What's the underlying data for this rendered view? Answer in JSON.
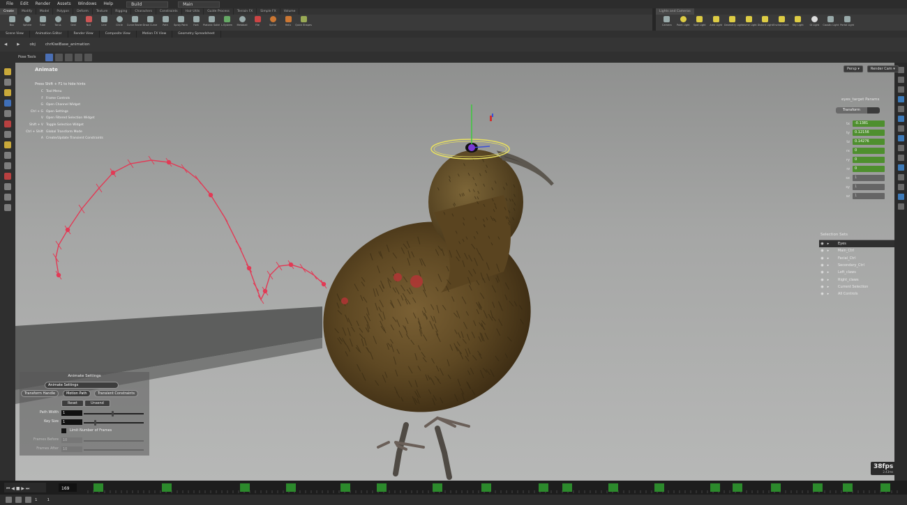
{
  "menu": {
    "items": [
      "File",
      "Edit",
      "Render",
      "Assets",
      "Windows",
      "Help"
    ],
    "desktop": "Build",
    "context": "Main"
  },
  "shelf": {
    "tabs": [
      "Create",
      "Modify",
      "Model",
      "Polygon",
      "Deform",
      "Texture",
      "Rigging",
      "Characters",
      "Constraints",
      "Hair Utils",
      "Guide Process",
      "Terrain FX",
      "Simple FX",
      "Volume"
    ],
    "tools": [
      "Box",
      "Sphere",
      "Tube",
      "Torus",
      "Grid",
      "Null",
      "Line",
      "Circle",
      "Curve Bezier",
      "Draw Curve",
      "Path",
      "Spray Paint",
      "Font",
      "Platonic Solids",
      "L-System",
      "Metaball",
      "File",
      "Spiral",
      "Helix",
      "Quick Shapes"
    ],
    "right_tab": "Lights and Cameras",
    "right_tools": [
      "Camera",
      "Point Light",
      "Spot Light",
      "Area Light",
      "Geometry Light",
      "Volume Light",
      "Distant Light",
      "Environment Light",
      "Sky Light",
      "GI Light",
      "Caustic Light",
      "Portal Light"
    ]
  },
  "pane_tabs": [
    "Scene View",
    "Animation Editor",
    "Render View",
    "Composite View",
    "Motion FX View",
    "Geometry Spreadsheet"
  ],
  "path": {
    "root": "obj",
    "node": "chrKiwiBase_animation"
  },
  "viewport_toolbar": {
    "label": "Pose Tools"
  },
  "hud": {
    "title": "Animate",
    "hint": "Press Shift + F1 to hide hints",
    "hotkeys": [
      {
        "key": "C",
        "desc": "Tool Menu"
      },
      {
        "key": "F",
        "desc": "Frame Controls"
      },
      {
        "key": "G",
        "desc": "Open Channel Widget"
      },
      {
        "key": "Ctrl + G",
        "desc": "Open Settings"
      },
      {
        "key": "V",
        "desc": "Open Filtered Selection Widget"
      },
      {
        "key": "Shift + V",
        "desc": "Toggle Selection Widget"
      },
      {
        "key": "Ctrl + Shift",
        "desc": "Global Transform Mode"
      },
      {
        "key": "A",
        "desc": "Create/Update Transient Constraints"
      }
    ]
  },
  "view_buttons": {
    "persp": "Persp ▾",
    "cam": "Render Cam ▾"
  },
  "transform_panel": {
    "header": "eyes_target Params",
    "mode": "Transform",
    "fields": [
      {
        "name": "tx",
        "value": "-0.1381",
        "active": true
      },
      {
        "name": "ty",
        "value": "0.12156",
        "active": true
      },
      {
        "name": "tz",
        "value": "0.14276",
        "active": true
      },
      {
        "name": "rx",
        "value": "0",
        "active": true
      },
      {
        "name": "ry",
        "value": "0",
        "active": true
      },
      {
        "name": "rz",
        "value": "0",
        "active": true
      },
      {
        "name": "sx",
        "value": "1",
        "active": false
      },
      {
        "name": "sy",
        "value": "1",
        "active": false
      },
      {
        "name": "sz",
        "value": "1",
        "active": false
      }
    ]
  },
  "selection_sets": {
    "header": "Selection Sets",
    "items": [
      "Eyes",
      "Main_Ctrl",
      "Facial_Ctrl",
      "Secondary_Ctrl",
      "Left_claws",
      "Right_claws",
      "Current Selection",
      "All Controls"
    ]
  },
  "animate_settings": {
    "header": "Animate Settings",
    "tab": "Animate Settings",
    "subtabs": [
      "Transform Handle",
      "Motion Path",
      "Transient Constraints"
    ],
    "actions": [
      "Reset",
      "Unsend"
    ],
    "path_width_label": "Path Width",
    "path_width": "1",
    "key_size_label": "Key Size",
    "key_size": "1",
    "limit_label": "Limit Number of Frames",
    "frames_before_label": "Frames Before",
    "frames_before": "10",
    "frames_after_label": "Frames After",
    "frames_after": "10"
  },
  "timeline": {
    "current_frame": "169",
    "start": "1",
    "end": "1"
  },
  "fps": {
    "value": "38fps",
    "sub": "2.43ms"
  },
  "colors": {
    "accent": "#4a6fb5",
    "keyframe": "#2c8a2c",
    "motion_path": "#e23a55",
    "param_active": "#4e8f2e"
  }
}
